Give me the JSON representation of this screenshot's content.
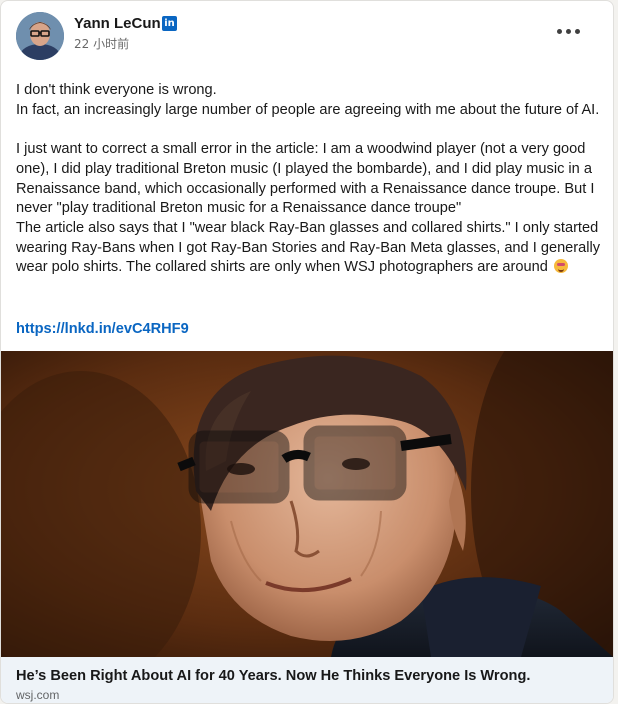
{
  "post": {
    "author": {
      "name": "Yann LeCun",
      "badge": "in",
      "timestamp": "22 小时前"
    },
    "body": {
      "p1_line1": "I don't think everyone is wrong.",
      "p1_line2": "In fact, an increasingly large number of people are agreeing with me about the future of AI.",
      "p2": "I just want to correct a small error in the article: I am a woodwind player (not a very good one), I did play traditional Breton music (I played the bombarde), and I did play music in a Renaissance band, which occasionally performed with a Renaissance dance troupe. But I never \"play traditional Breton music for a Renaissance dance troupe\"",
      "p3": "The article also says that I \"wear black Ray-Ban glasses and collared shirts.\" I only started wearing Ray-Bans when I got Ray-Ban Stories and Ray-Ban Meta glasses, and I generally wear polo shirts. The collared shirts are only when WSJ photographers are around"
    },
    "link": "https://lnkd.in/evC4RHF9",
    "article": {
      "title": "He’s Been Right About AI for 40 Years. Now He Thinks Everyone Is Wrong.",
      "source": "wsj.com"
    }
  },
  "icons": {
    "more": "more-horizontal-icon",
    "linkedin_badge": "linkedin-icon",
    "emoji": "grinning-face-emoji"
  },
  "colors": {
    "link": "#0a66c2",
    "linkedin_blue": "#0a66c2",
    "article_footer_bg": "#eef3f8",
    "card_bg": "#ffffff",
    "page_bg": "#f3f2ef"
  }
}
